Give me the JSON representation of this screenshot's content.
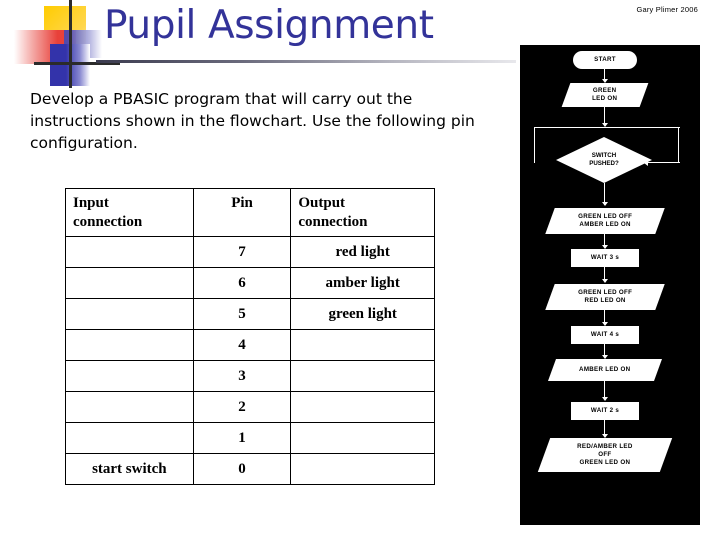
{
  "author": "Gary Plimer 2006",
  "slide": {
    "title": "Pupil Assignment",
    "body": "Develop a PBASIC program that will carry out the instructions shown in the flowchart. Use the following pin configuration."
  },
  "table": {
    "headers": [
      "Input\nconnection",
      "Pin",
      "Output\nconnection"
    ],
    "rows": [
      {
        "input": "",
        "pin": "7",
        "output": "red light"
      },
      {
        "input": "",
        "pin": "6",
        "output": "amber light"
      },
      {
        "input": "",
        "pin": "5",
        "output": "green light"
      },
      {
        "input": "",
        "pin": "4",
        "output": ""
      },
      {
        "input": "",
        "pin": "3",
        "output": ""
      },
      {
        "input": "",
        "pin": "2",
        "output": ""
      },
      {
        "input": "",
        "pin": "1",
        "output": ""
      },
      {
        "input": "start switch",
        "pin": "0",
        "output": ""
      }
    ]
  },
  "flowchart": {
    "nodes": [
      {
        "id": "start",
        "type": "terminal",
        "label": "START"
      },
      {
        "id": "green_on",
        "type": "io",
        "label": "GREEN\nLED ON"
      },
      {
        "id": "switch",
        "type": "decision",
        "label": "SWITCH\nPUSHED?"
      },
      {
        "id": "green_off_amber_on",
        "type": "io",
        "label": "GREEN LED OFF\nAMBER LED ON"
      },
      {
        "id": "wait3",
        "type": "process",
        "label": "WAIT 3 s"
      },
      {
        "id": "green_off_red_on",
        "type": "io",
        "label": "GREEN LED OFF\nRED LED ON"
      },
      {
        "id": "wait4",
        "type": "process",
        "label": "WAIT 4 s"
      },
      {
        "id": "amber_on",
        "type": "io",
        "label": "AMBER LED ON"
      },
      {
        "id": "wait2",
        "type": "process",
        "label": "WAIT 2 s"
      },
      {
        "id": "red_amber_off_green_on",
        "type": "io",
        "label": "RED/AMBER LED\nOFF\nGREEN LED ON"
      }
    ]
  },
  "colors": {
    "title": "#333399",
    "panel_background": "#000000",
    "node_fill": "#ffffff",
    "text": "#000000"
  }
}
